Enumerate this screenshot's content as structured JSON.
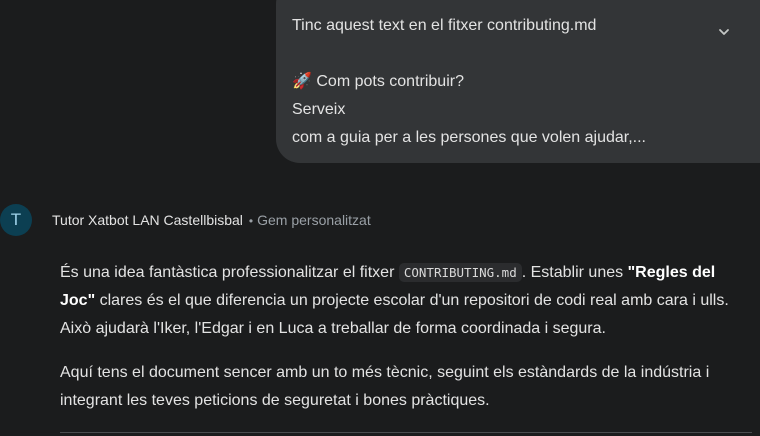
{
  "user_message": {
    "line1": "Tinc aquest text en el fitxer contributing.md",
    "line2": "🚀 Com pots contribuir?",
    "line3": "Serveix",
    "line4": "com a guia per a les persones que volen ajudar,..."
  },
  "expand_icon": "chevron-down-icon",
  "bot": {
    "avatar_letter": "T",
    "name": "Tutor Xatbot LAN Castellbisbal",
    "separator": "•",
    "tag": "Gem personalitzat"
  },
  "response": {
    "p1_a": "És una idea fantàstica professionalitzar el fitxer ",
    "p1_code": "CONTRIBUTING.md",
    "p1_b": ". Establir unes ",
    "p1_bold": "\"Regles del Joc\"",
    "p1_c": " clares és el que diferencia un projecte escolar d'un repositori de codi real amb cara i ulls. Això ajudarà l'Iker, l'Edgar i en Luca a treballar de forma coordinada i segura.",
    "p2": "Aquí tens el document sencer amb un to més tècnic, seguint els estàndards de la indústria i integrant les teves peticions de seguretat i bones pràctiques."
  },
  "colors": {
    "background": "#1b1c1d",
    "user_bubble": "#333537",
    "avatar_bg": "#0c3f52",
    "text": "#e3e3e3",
    "muted": "#9aa0a6"
  }
}
